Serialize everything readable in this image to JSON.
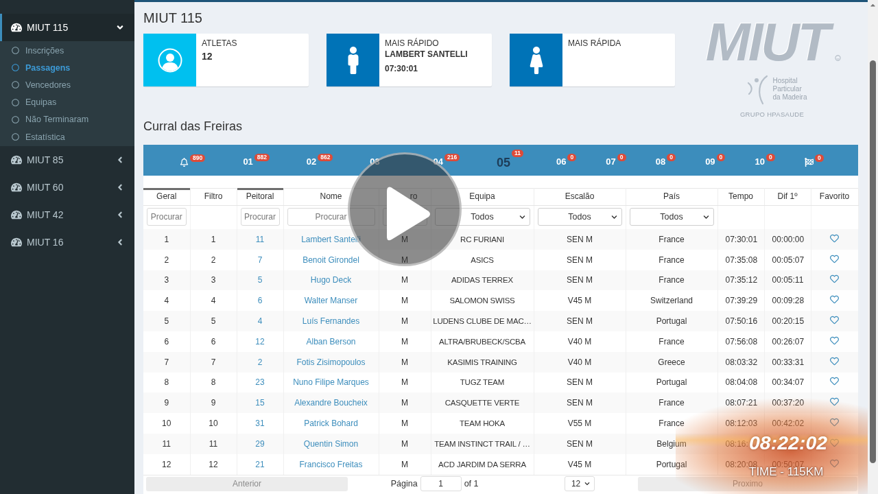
{
  "sidebar": {
    "items": [
      {
        "label": "MIUT 115",
        "expanded": true,
        "children": [
          {
            "label": "Inscrições",
            "selected": false
          },
          {
            "label": "Passagens",
            "selected": true
          },
          {
            "label": "Vencedores",
            "selected": false
          },
          {
            "label": "Equipas",
            "selected": false
          },
          {
            "label": "Não Terminaram",
            "selected": false
          },
          {
            "label": "Estatística",
            "selected": false
          }
        ]
      },
      {
        "label": "MIUT 85",
        "expanded": false
      },
      {
        "label": "MIUT 60",
        "expanded": false
      },
      {
        "label": "MIUT 42",
        "expanded": false
      },
      {
        "label": "MIUT 16",
        "expanded": false
      }
    ]
  },
  "page_title": "MIUT 115",
  "info_boxes": [
    {
      "kind": "athletes",
      "color": "#00c0ef",
      "title": "ATLETAS",
      "value": "12"
    },
    {
      "kind": "male",
      "color": "#0073b7",
      "title": "MAIS RÁPIDO",
      "name": "LAMBERT SANTELLI",
      "time": "07:30:01"
    },
    {
      "kind": "female",
      "color": "#0073b7",
      "title": "MAIS RÁPIDA"
    }
  ],
  "logo": {
    "wordmark": "MIUT",
    "sponsor": [
      "Hospital",
      "Particular",
      "da Madeira"
    ],
    "group": "GRUPO HPASAUDE"
  },
  "section_title": "Curral das Freiras",
  "checkpoints": [
    {
      "kind": "start",
      "count": "890",
      "selected": false
    },
    {
      "kind": "point",
      "label": "01",
      "count": "882",
      "selected": false
    },
    {
      "kind": "point",
      "label": "02",
      "count": "862",
      "selected": false
    },
    {
      "kind": "point",
      "label": "03",
      "selected": false
    },
    {
      "kind": "point",
      "label": "04",
      "count": "216",
      "selected": false
    },
    {
      "kind": "point",
      "label": "05",
      "count": "11",
      "selected": true
    },
    {
      "kind": "point",
      "label": "06",
      "count": "0",
      "selected": false
    },
    {
      "kind": "point",
      "label": "07",
      "count": "0",
      "selected": false
    },
    {
      "kind": "point",
      "label": "08",
      "count": "0",
      "selected": false
    },
    {
      "kind": "point",
      "label": "09",
      "count": "0",
      "selected": false
    },
    {
      "kind": "point",
      "label": "10",
      "count": "0",
      "selected": false
    },
    {
      "kind": "finish",
      "count": "0",
      "selected": false
    }
  ],
  "table": {
    "columns": [
      {
        "label": "Geral",
        "sorted": true,
        "filter": {
          "kind": "search",
          "placeholder": "Procurar"
        }
      },
      {
        "label": "Filtro",
        "sorted": false
      },
      {
        "label": "Peitoral",
        "sorted": true,
        "filter": {
          "kind": "search",
          "placeholder": "Procurar"
        }
      },
      {
        "label": "Nome",
        "sorted": false,
        "filter": {
          "kind": "search",
          "placeholder": "Procurar"
        }
      },
      {
        "label": "ro",
        "filter": {
          "kind": "search"
        }
      },
      {
        "label": "Equipa",
        "sorted": false,
        "filter": {
          "kind": "select",
          "value": "Todos"
        }
      },
      {
        "label": "Escalão",
        "sorted": false,
        "filter": {
          "kind": "select",
          "value": "Todos"
        }
      },
      {
        "label": "País",
        "sorted": false,
        "filter": {
          "kind": "select",
          "value": "Todos"
        }
      },
      {
        "label": "Tempo",
        "sorted": false
      },
      {
        "label": "Dif 1º",
        "sorted": false
      },
      {
        "label": "Favorito",
        "sorted": false
      }
    ],
    "rows": [
      {
        "geral": "1",
        "filtro": "1",
        "peitoral": "11",
        "nome": "Lambert Santelli",
        "sexo": "M",
        "equipa": "RC FURIANI",
        "escalao": "SEN M",
        "pais": "France",
        "tempo": "07:30:01",
        "dif": "00:00:00",
        "favorite": false
      },
      {
        "geral": "2",
        "filtro": "2",
        "peitoral": "7",
        "nome": "Benoit Girondel",
        "sexo": "M",
        "equipa": "ASICS",
        "escalao": "SEN M",
        "pais": "France",
        "tempo": "07:35:08",
        "dif": "00:05:07",
        "favorite": false
      },
      {
        "geral": "3",
        "filtro": "3",
        "peitoral": "5",
        "nome": "Hugo Deck",
        "sexo": "M",
        "equipa": "ADIDAS TERREX",
        "escalao": "SEN M",
        "pais": "France",
        "tempo": "07:35:12",
        "dif": "00:05:11",
        "favorite": false
      },
      {
        "geral": "4",
        "filtro": "4",
        "peitoral": "6",
        "nome": "Walter Manser",
        "sexo": "M",
        "equipa": "SALOMON SWISS",
        "escalao": "V45 M",
        "pais": "Switzerland",
        "tempo": "07:39:29",
        "dif": "00:09:28",
        "favorite": false
      },
      {
        "geral": "5",
        "filtro": "5",
        "peitoral": "4",
        "nome": "Luís Fernandes",
        "sexo": "M",
        "equipa": "LUDENS CLUBE DE MAC…",
        "escalao": "SEN M",
        "pais": "Portugal",
        "tempo": "07:50:16",
        "dif": "00:20:15",
        "favorite": false
      },
      {
        "geral": "6",
        "filtro": "6",
        "peitoral": "12",
        "nome": "Alban Berson",
        "sexo": "M",
        "equipa": "ALTRA/BRUBECK/SCBA",
        "escalao": "V40 M",
        "pais": "France",
        "tempo": "07:56:08",
        "dif": "00:26:07",
        "favorite": false
      },
      {
        "geral": "7",
        "filtro": "7",
        "peitoral": "2",
        "nome": "Fotis Zisimopoulos",
        "sexo": "M",
        "equipa": "KASIMIS TRAINING",
        "escalao": "V40 M",
        "pais": "Greece",
        "tempo": "08:03:32",
        "dif": "00:33:31",
        "favorite": false
      },
      {
        "geral": "8",
        "filtro": "8",
        "peitoral": "23",
        "nome": "Nuno Filipe Marques",
        "sexo": "M",
        "equipa": "TUGZ TEAM",
        "escalao": "SEN M",
        "pais": "Portugal",
        "tempo": "08:04:08",
        "dif": "00:34:07",
        "favorite": false
      },
      {
        "geral": "9",
        "filtro": "9",
        "peitoral": "15",
        "nome": "Alexandre Boucheix",
        "sexo": "M",
        "equipa": "CASQUETTE VERTE",
        "escalao": "SEN M",
        "pais": "France",
        "tempo": "08:07:21",
        "dif": "00:37:20",
        "favorite": false
      },
      {
        "geral": "10",
        "filtro": "10",
        "peitoral": "31",
        "nome": "Patrick Bohard",
        "sexo": "M",
        "equipa": "TEAM HOKA",
        "escalao": "V55 M",
        "pais": "France",
        "tempo": "08:12:03",
        "dif": "00:42:02",
        "favorite": false
      },
      {
        "geral": "11",
        "filtro": "11",
        "peitoral": "29",
        "nome": "Quentin Simon",
        "sexo": "M",
        "equipa": "TEAM INSTINCT TRAIL / …",
        "escalao": "SEN M",
        "pais": "Belgium",
        "tempo": "08:16:",
        "favorite": false
      },
      {
        "geral": "12",
        "filtro": "12",
        "peitoral": "21",
        "nome": "Francisco Freitas",
        "sexo": "M",
        "equipa": "ACD JARDIM DA SERRA",
        "escalao": "V45 M",
        "pais": "Portugal",
        "tempo": "08:20:08",
        "dif": "00:50:07",
        "favorite": false
      }
    ]
  },
  "pagination": {
    "previous": {
      "label": "Anterior",
      "disabled": true
    },
    "page_label": "Página",
    "page": "1",
    "page_total": "of 1",
    "page_size": "12",
    "next": {
      "label": "Proximo",
      "disabled": true
    }
  },
  "broadcast_overlay": {
    "clock": "08:22:02",
    "caption": "TIME - 115KM"
  }
}
